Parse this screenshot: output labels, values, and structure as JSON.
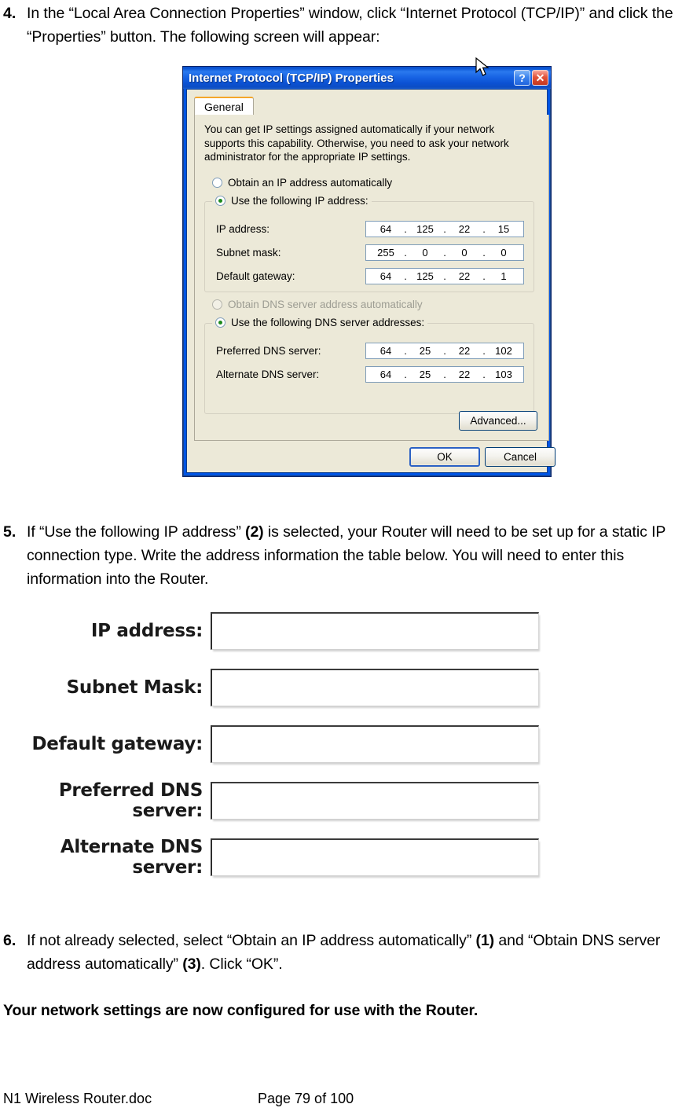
{
  "document": {
    "steps": [
      {
        "number": "4.",
        "text": "In the “Local Area Connection Properties” window, click “Internet Protocol (TCP/IP)” and click the “Properties” button. The following screen will appear:"
      },
      {
        "number": "5.",
        "text": "If “Use the following IP address” (2) is selected, your Router will need to be set up for a static IP connection type. Write the address information the table below. You will need to enter this information into the Router."
      },
      {
        "number": "6.",
        "text": "If not already selected, select “Obtain an IP address automatically” (1) and “Obtain DNS server address automatically” (3). Click “OK”."
      }
    ],
    "closing_line": "Your network settings are now configured for use with the Router.",
    "footer": {
      "doc_name": "N1 Wireless Router.doc",
      "page_label": "Page 79 of 100"
    }
  },
  "dialog": {
    "title": "Internet Protocol (TCP/IP) Properties",
    "title_buttons": {
      "help": "?",
      "close": "✕"
    },
    "tab": {
      "label": "General"
    },
    "intro_text": "You can get IP settings assigned automatically if your network supports this capability. Otherwise, you need to ask your network administrator for the appropriate IP settings.",
    "radios": {
      "obtain_ip": {
        "label": "Obtain an IP address automatically",
        "checked": false,
        "disabled": false
      },
      "use_following_ip": {
        "label": "Use the following IP address:",
        "checked": true,
        "disabled": false
      },
      "obtain_dns": {
        "label": "Obtain DNS server address automatically",
        "checked": false,
        "disabled": true
      },
      "use_following_dns": {
        "label": "Use the following DNS server addresses:",
        "checked": true,
        "disabled": false
      }
    },
    "ip_fields": [
      {
        "label": "IP address:",
        "octets": [
          "64",
          "125",
          "22",
          "15"
        ]
      },
      {
        "label": "Subnet mask:",
        "octets": [
          "255",
          "0",
          "0",
          "0"
        ]
      },
      {
        "label": "Default gateway:",
        "octets": [
          "64",
          "125",
          "22",
          "1"
        ]
      }
    ],
    "dns_fields": [
      {
        "label": "Preferred DNS server:",
        "octets": [
          "64",
          "25",
          "22",
          "102"
        ]
      },
      {
        "label": "Alternate DNS server:",
        "octets": [
          "64",
          "25",
          "22",
          "103"
        ]
      }
    ],
    "buttons": {
      "advanced": "Advanced...",
      "ok": "OK",
      "cancel": "Cancel"
    },
    "colors": {
      "titlebar_blue": "#0054e3",
      "dialog_face": "#ece9d8",
      "tab_accent": "#f4a62a",
      "radio_dot_green": "#1c8a1c",
      "close_red": "#c3361d"
    }
  },
  "blank_form": {
    "rows": [
      {
        "label": "IP address:",
        "value": ""
      },
      {
        "label": "Subnet Mask:",
        "value": ""
      },
      {
        "label": "Default gateway:",
        "value": ""
      },
      {
        "label": "Preferred DNS server:",
        "value": ""
      },
      {
        "label": "Alternate DNS server:",
        "value": ""
      }
    ]
  }
}
